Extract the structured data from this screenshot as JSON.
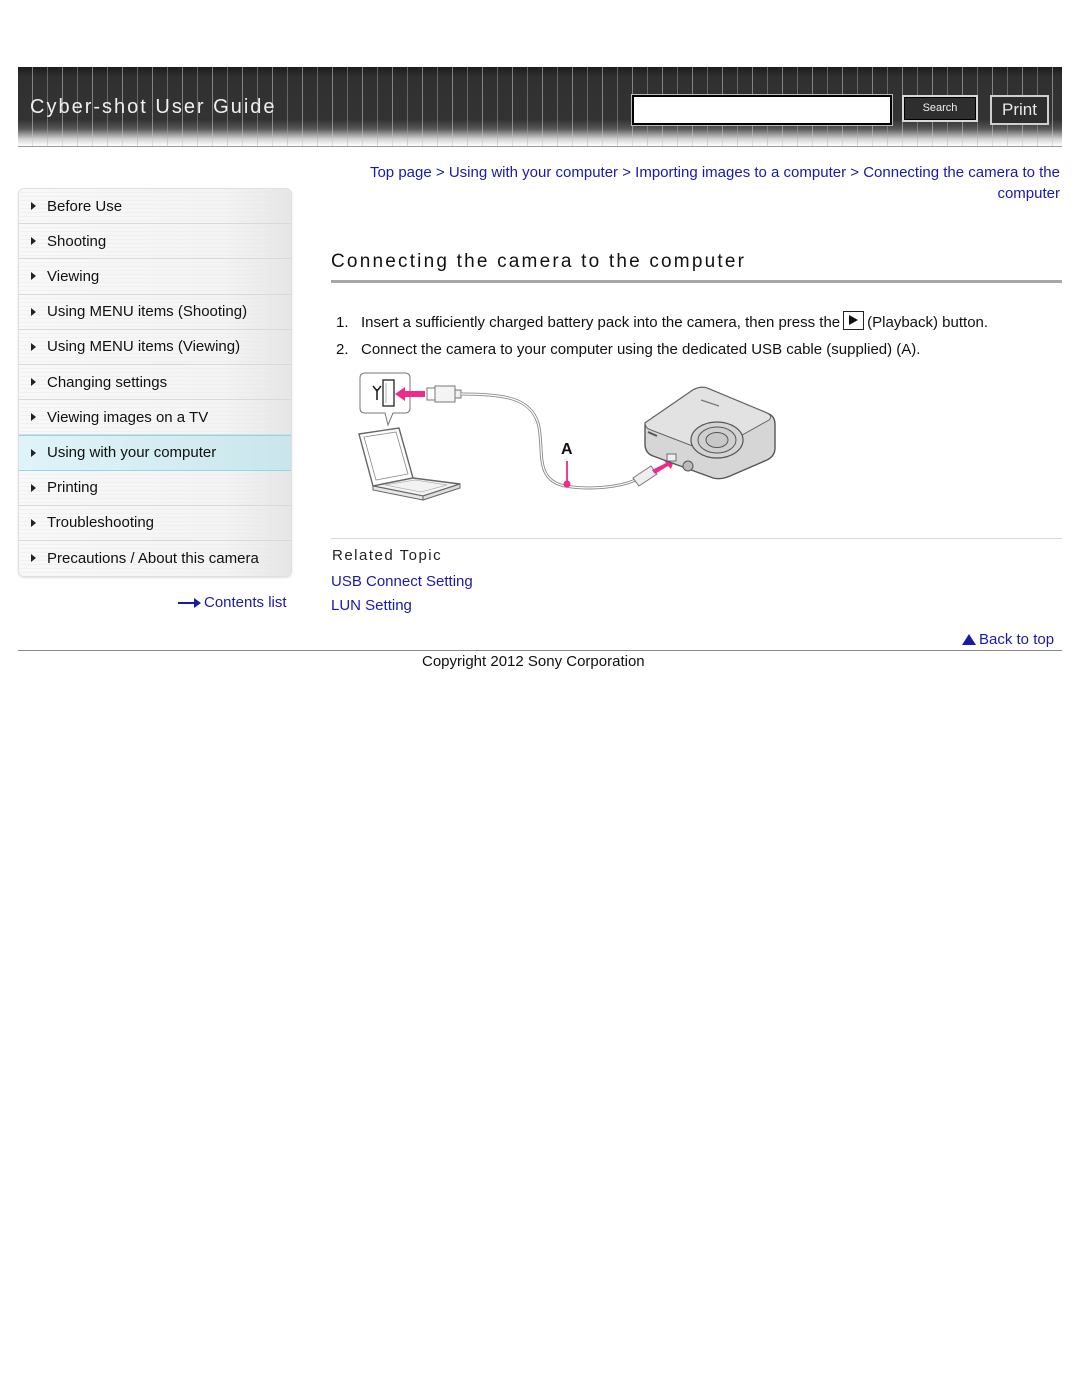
{
  "header": {
    "title": "Cyber-shot User Guide",
    "search": {
      "value": "",
      "placeholder": ""
    },
    "search_button_label": "Search",
    "print_button_label": "Print"
  },
  "sidebar": {
    "items": [
      {
        "label": "Before Use",
        "active": false
      },
      {
        "label": "Shooting",
        "active": false
      },
      {
        "label": "Viewing",
        "active": false
      },
      {
        "label": "Using MENU items (Shooting)",
        "active": false
      },
      {
        "label": "Using MENU items (Viewing)",
        "active": false
      },
      {
        "label": "Changing settings",
        "active": false
      },
      {
        "label": "Viewing images on a TV",
        "active": false
      },
      {
        "label": "Using with your computer",
        "active": true
      },
      {
        "label": "Printing",
        "active": false
      },
      {
        "label": "Troubleshooting",
        "active": false
      },
      {
        "label": "Precautions / About this camera",
        "active": false
      }
    ],
    "contents_link": "Contents list"
  },
  "breadcrumb": {
    "items": [
      "Top page",
      "Using with your computer",
      "Importing images to a computer",
      "Connecting the camera to the computer"
    ],
    "separator": ">"
  },
  "main": {
    "title": "Connecting the camera to the computer",
    "steps": [
      {
        "number": "1.",
        "text_before": "Insert a sufficiently charged battery pack into the camera, then press the",
        "icon": "playback-icon",
        "text_after": "(Playback) button."
      },
      {
        "number": "2.",
        "text": "Connect the camera to your computer using the dedicated USB cable (supplied) (A)."
      }
    ],
    "diagram": {
      "callout_label": "A",
      "accent_color": "#ee2b8a"
    },
    "related": {
      "heading": "Related Topic",
      "links": [
        "USB Connect Setting",
        "LUN Setting"
      ]
    },
    "back_to_top": "Back to top"
  },
  "footer": {
    "copyright": "Copyright 2012 Sony Corporation"
  },
  "colors": {
    "link": "#1a1aa6",
    "active_nav_bg": "#d3ecf1",
    "active_nav_border": "#8fd8ea",
    "header_bg": "#333333"
  }
}
